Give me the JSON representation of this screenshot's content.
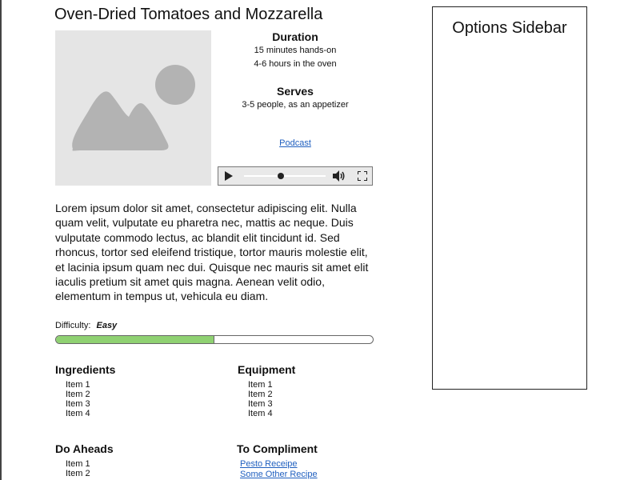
{
  "recipe": {
    "title": "Oven-Dried Tomatoes and Mozzarella",
    "image_icon": "image-placeholder-icon",
    "duration": {
      "heading": "Duration",
      "lines": [
        "15 minutes hands-on",
        "4-6 hours in the oven"
      ]
    },
    "serves": {
      "heading": "Serves",
      "line": "3-5 people, as an appetizer"
    },
    "podcast_label": "Podcast",
    "player": {
      "play_icon": "play-icon",
      "volume_icon": "volume-icon",
      "fullscreen_icon": "fullscreen-icon",
      "progress": 0.45
    },
    "description": "Lorem ipsum dolor sit amet, consectetur adipiscing elit. Nulla quam velit, vulputate eu pharetra nec, mattis ac neque. Duis vulputate commodo lectus, ac blandit elit tincidunt id. Sed rhoncus, tortor sed eleifend tristique, tortor mauris molestie elit, et lacinia ipsum quam nec dui. Quisque nec mauris sit amet elit iaculis pretium sit amet quis magna. Aenean velit odio, elementum in tempus ut, vehicula eu diam.",
    "difficulty": {
      "label": "Difficulty:",
      "value": "Easy",
      "level": 0.5,
      "fill_color": "#8fd172"
    },
    "ingredients": {
      "heading": "Ingredients",
      "items": [
        "Item 1",
        "Item 2",
        "Item 3",
        "Item 4"
      ]
    },
    "equipment": {
      "heading": "Equipment",
      "items": [
        "Item 1",
        "Item 2",
        "Item 3",
        "Item 4"
      ]
    },
    "do_aheads": {
      "heading": "Do Aheads",
      "items": [
        "Item 1",
        "Item 2"
      ]
    },
    "to_compliment": {
      "heading": "To Compliment",
      "links": [
        "Pesto Receipe",
        "Some Other Recipe"
      ]
    }
  },
  "sidebar": {
    "title": "Options Sidebar"
  },
  "colors": {
    "link": "#1f5fbf",
    "image_bg": "#e5e5e5",
    "image_shape": "#b3b3b3"
  }
}
